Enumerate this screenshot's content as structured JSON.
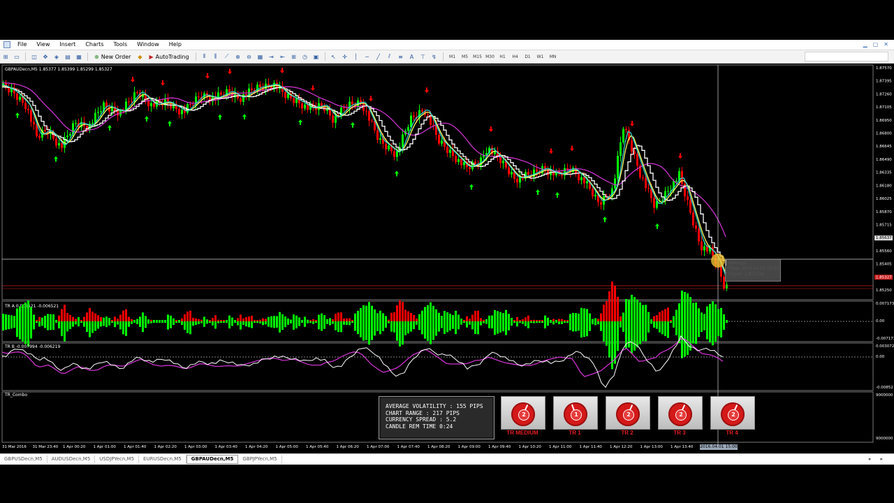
{
  "menu": [
    "File",
    "View",
    "Insert",
    "Charts",
    "Tools",
    "Window",
    "Help"
  ],
  "toolbar": {
    "new_order": "New Order",
    "autotrading": "AutoTrading",
    "timeframes": [
      "M1",
      "M5",
      "M15",
      "M30",
      "H1",
      "H4",
      "D1",
      "W1",
      "MN"
    ]
  },
  "chart": {
    "header": "GBPAUDecn,M5  1.85377 1.85399 1.85299 1.85327",
    "price_ticks": [
      "1.87570",
      "1.87395",
      "1.87260",
      "1.87105",
      "1.86950",
      "1.86800",
      "1.86645",
      "1.86490",
      "1.86335",
      "1.86180",
      "1.86025",
      "1.85870",
      "1.85715",
      "1.85637",
      "1.85560",
      "1.85405",
      "1.85327",
      "1.85250"
    ],
    "time_ticks": [
      "31 Mar 2016",
      "31 Mar 23:40",
      "1 Apr 00:20",
      "1 Apr 01:00",
      "1 Apr 01:40",
      "1 Apr 02:20",
      "1 Apr 03:00",
      "1 Apr 03:40",
      "1 Apr 04:20",
      "1 Apr 05:00",
      "1 Apr 05:40",
      "1 Apr 06:20",
      "1 Apr 07:00",
      "1 Apr 07:40",
      "1 Apr 08:20",
      "1 Apr 09:00",
      "1 Apr 09:40",
      "1 Apr 10:20",
      "1 Apr 11:00",
      "1 Apr 11:40",
      "1 Apr 12:20",
      "1 Apr 13:00",
      "1 Apr 13:40",
      "1 Apr"
    ],
    "cursor_time": "2016.04.01 15:00",
    "tooltip": [
      "Average",
      "Time: 2016.04.01 15:00",
      "Signal: 1.857316"
    ],
    "colors": {
      "bull": "#00ff00",
      "bear": "#ff0000",
      "ma_white": "#ffffff",
      "ma_yellow": "#ffff66",
      "ma_cyan": "#33cccc",
      "ma_magenta": "#cc33cc"
    }
  },
  "indicators": {
    "tra": {
      "label": "TR A 0.006521 -0.006521",
      "ticks": [
        "0.007173",
        "0.00",
        "-0.007173"
      ]
    },
    "trb": {
      "label": "TR B -0.007994 -0.006219",
      "ticks": [
        "0.003072",
        "0.00",
        "-0.00852"
      ]
    },
    "combo": {
      "label": "TR_Combo",
      "ticks": [
        "9000000",
        "9000000"
      ]
    }
  },
  "infobox": [
    "AVERAGE VOLATILITY : 155 PIPS",
    "CHART RANGE : 217 PIPS",
    "CURRENCY SPREAD : 5.2",
    "CANDLE REM TIME   0:24"
  ],
  "gauges": [
    {
      "label": "TR MEDIUM",
      "value": "2"
    },
    {
      "label": "TR 1",
      "value": "1"
    },
    {
      "label": "TR 2",
      "value": "2"
    },
    {
      "label": "TR 3",
      "value": "2"
    },
    {
      "label": "TR 4",
      "value": "2"
    }
  ],
  "tabs": [
    "GBPUSDecn,M5",
    "AUDUSDecn,M5",
    "USDJPYecn,M5",
    "EURUSDecn,M5",
    "GBPAUDecn,M5",
    "GBPJPYecn,M5"
  ],
  "active_tab": "GBPAUDecn,M5"
}
